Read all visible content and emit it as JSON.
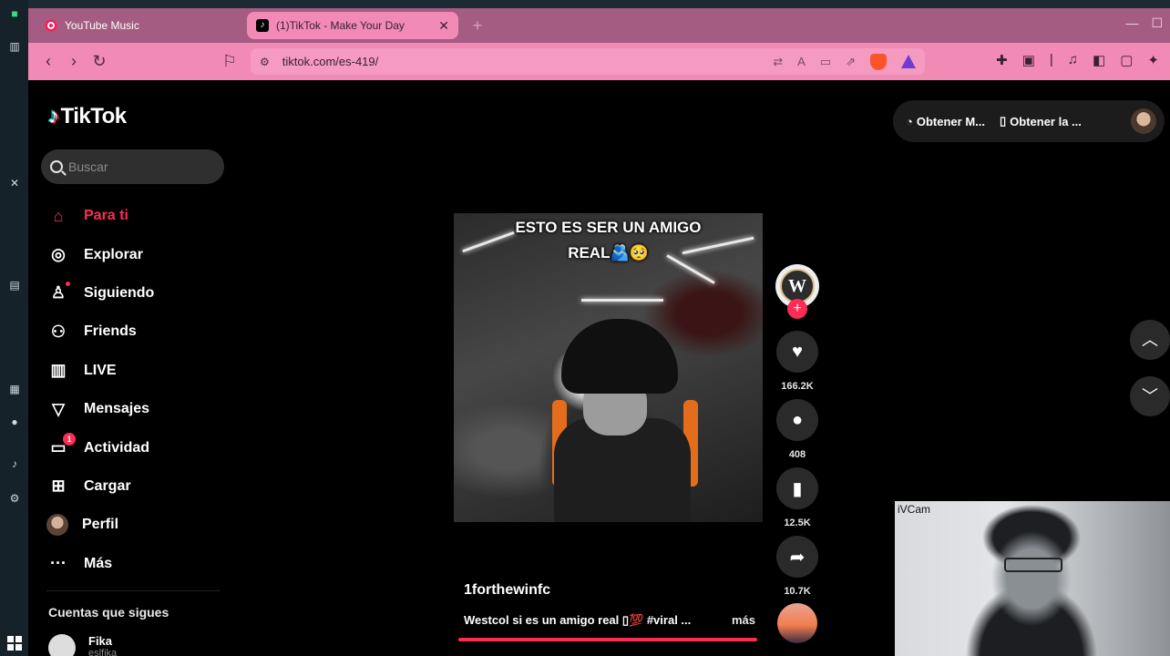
{
  "browser": {
    "tabs": [
      {
        "title": "YouTube Music",
        "active": false
      },
      {
        "title": "(1)TikTok - Make Your Day",
        "active": true
      }
    ],
    "url": "tiktok.com/es-419/",
    "accent_color": "#f28ab6",
    "tabbar_color": "#a45c82"
  },
  "sidebar": {
    "logo": "TikTok",
    "search_placeholder": "Buscar",
    "items": [
      {
        "label": "Para ti",
        "icon": "home-icon",
        "active": true
      },
      {
        "label": "Explorar",
        "icon": "compass-icon"
      },
      {
        "label": "Siguiendo",
        "icon": "following-icon"
      },
      {
        "label": "Friends",
        "icon": "friends-icon"
      },
      {
        "label": "LIVE",
        "icon": "live-icon"
      },
      {
        "label": "Mensajes",
        "icon": "send-icon"
      },
      {
        "label": "Actividad",
        "icon": "inbox-icon",
        "badge": "1"
      },
      {
        "label": "Cargar",
        "icon": "upload-icon"
      },
      {
        "label": "Perfil",
        "icon": "avatar-icon"
      },
      {
        "label": "Más",
        "icon": "more-icon"
      }
    ],
    "following_title": "Cuentas que sigues",
    "following": [
      {
        "name": "Fika",
        "handle": "eslfika"
      }
    ]
  },
  "header": {
    "pill_items": [
      "Obtener M...",
      "Obtener la ..."
    ]
  },
  "video": {
    "caption_line1": "ESTO ES SER UN AMIGO",
    "caption_line2": "REAL🫂🥺",
    "author": "1forthewinfc",
    "description": "Westcol si es un amigo real ▯💯 #viral ...",
    "more": "más",
    "likes": "166.2K",
    "comments": "408",
    "saves": "12.5K",
    "shares": "10.7K"
  },
  "webcam": {
    "label": "iVCam"
  },
  "colors": {
    "brand_pink": "#fe2c55",
    "background": "#000000"
  }
}
